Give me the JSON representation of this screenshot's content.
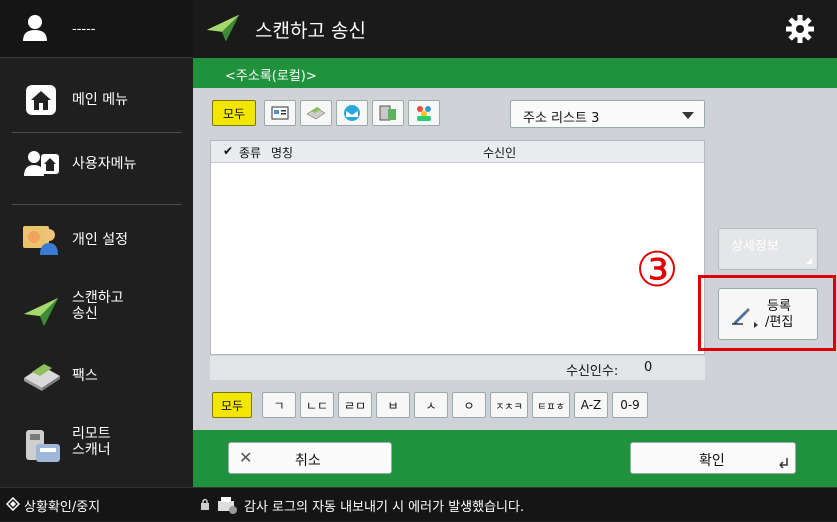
{
  "user": {
    "name": "-----"
  },
  "sidebar": {
    "items": [
      {
        "label": "메인 메뉴",
        "icon": "home-icon"
      },
      {
        "label": "사용자메뉴",
        "icon": "user-home-icon"
      },
      {
        "label": "개인 설정",
        "icon": "personal-settings-icon"
      },
      {
        "label": "스캔하고\n송신",
        "icon": "send-plane-icon"
      },
      {
        "label": "팩스",
        "icon": "fax-icon"
      },
      {
        "label": "리모트\n스캐너",
        "icon": "remote-scanner-icon"
      }
    ]
  },
  "header": {
    "title": "스캔하고 송신"
  },
  "addressbook": {
    "title": "<주소록(로컬)>",
    "type_all": "모두",
    "list_select": "주소 리스트 3",
    "columns": {
      "type": "종류",
      "name": "명칭",
      "recipient": "수신인"
    },
    "count_label": "수신인수:",
    "count_value": "0",
    "index_buttons": [
      "모두",
      "ㄱ",
      "ㄴㄷ",
      "ㄹㅁ",
      "ㅂ",
      "ㅅ",
      "ㅇ",
      "ㅈㅊㅋ",
      "ㅌㅍㅎ",
      "A-Z",
      "0-9"
    ]
  },
  "actions": {
    "details": "상세정보",
    "register_line1": "등록",
    "register_line2": "/편집",
    "callout": "③",
    "cancel": "취소",
    "confirm": "확인"
  },
  "statusbar": {
    "status_button": "상황확인/중지",
    "message": "감사 로그의 자동 내보내기 시 에러가 발생했습니다."
  },
  "colors": {
    "green": "#20913d",
    "highlight": "#e00000",
    "active_filter": "#f2e600"
  }
}
